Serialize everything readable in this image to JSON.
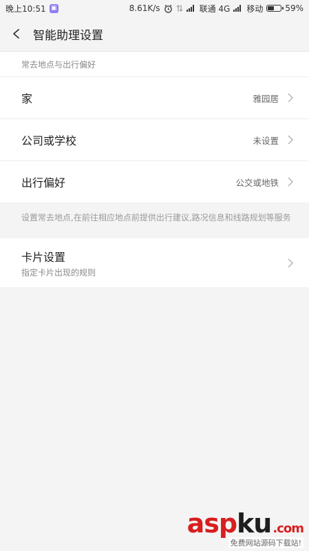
{
  "status_bar": {
    "time": "晚上10:51",
    "net_speed": "8.61K/s",
    "carrier1": "联通 4G",
    "carrier2": "移动",
    "battery": "59%",
    "battery_level": 0.59
  },
  "app_bar": {
    "title": "智能助理设置"
  },
  "section": {
    "header": "常去地点与出行偏好",
    "rows": [
      {
        "label": "家",
        "value": "雅园居"
      },
      {
        "label": "公司或学校",
        "value": "未设置"
      },
      {
        "label": "出行偏好",
        "value": "公交或地铁"
      }
    ]
  },
  "hint": "设置常去地点,在前往相应地点前提供出行建议,路况信息和线路规划等服务",
  "card_settings": {
    "title": "卡片设置",
    "subtitle": "指定卡片出现的规则"
  },
  "watermark": {
    "brand_a": "asp",
    "brand_b": "ku",
    "brand_c": ".com",
    "tagline": "免费网站源码下载站!"
  },
  "icons": {
    "back": "chevron-left-icon",
    "row_arrow": "chevron-right-icon",
    "alarm": "alarm-icon",
    "signal": "signal-icon",
    "battery": "battery-icon",
    "notification": "app-notification-icon"
  },
  "colors": {
    "background": "#f4f4f4",
    "card": "#ffffff",
    "text_primary": "#222222",
    "text_secondary": "#888888",
    "watermark_red": "#d81e1e"
  }
}
